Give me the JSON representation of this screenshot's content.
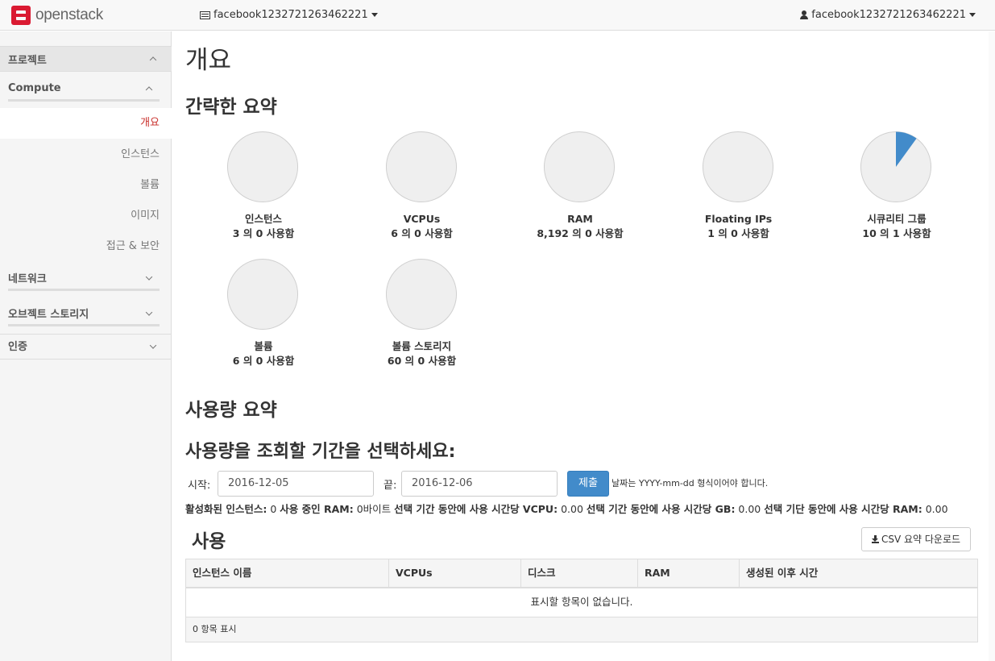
{
  "app": {
    "logo_text": "openstack"
  },
  "topbar": {
    "project": "facebook1232721263462221",
    "user": "facebook1232721263462221"
  },
  "sidebar": {
    "project_label": "프로젝트",
    "compute_label": "Compute",
    "items": [
      {
        "label": "개요",
        "active": true
      },
      {
        "label": "인스턴스"
      },
      {
        "label": "볼륨"
      },
      {
        "label": "이미지"
      },
      {
        "label": "접근 & 보안"
      }
    ],
    "network_label": "네트워크",
    "object_storage_label": "오브젝트 스토리지",
    "identity_label": "인증"
  },
  "main": {
    "title": "개요",
    "summary_heading": "간략한 요약",
    "quotas": [
      {
        "name": "인스턴스",
        "text": "3 의 0 사용함",
        "used": 0,
        "total": 3
      },
      {
        "name": "VCPUs",
        "text": "6 의 0 사용함",
        "used": 0,
        "total": 6
      },
      {
        "name": "RAM",
        "text": "8,192 의 0 사용함",
        "used": 0,
        "total": 8192
      },
      {
        "name": "Floating IPs",
        "text": "1 의 0 사용함",
        "used": 0,
        "total": 1
      },
      {
        "name": "시큐리티 그룹",
        "text": "10 의 1 사용함",
        "used": 1,
        "total": 10
      },
      {
        "name": "볼륨",
        "text": "6 의 0 사용함",
        "used": 0,
        "total": 6
      },
      {
        "name": "볼륨 스토리지",
        "text": "60 의 0 사용함",
        "used": 0,
        "total": 60
      }
    ],
    "usage_heading": "사용량 요약",
    "period_heading": "사용량을 조회할 기간을 선택하세요:",
    "start_label": "시작:",
    "start_value": "2016-12-05",
    "end_label": "끝:",
    "end_value": "2016-12-06",
    "submit_label": "제출",
    "date_hint": "날짜는 YYYY-mm-dd 형식이어야 합니다.",
    "stats": {
      "active_instances_label": "활성화된 인스턴스:",
      "active_instances_value": "0",
      "ram_label": "사용 중인 RAM:",
      "ram_value": "0바이트",
      "vcpu_label": "선택 기간 동안에 사용 시간당 VCPU:",
      "vcpu_value": "0.00",
      "gb_label": "선택 기간 동안에 사용 시간당 GB:",
      "gb_value": "0.00",
      "ram_hours_label": "선택 기단 동안에 사용 시간당 RAM:",
      "ram_hours_value": "0.00"
    },
    "usage_table_heading": "사용",
    "csv_button": "CSV 요약 다운로드",
    "table": {
      "columns": [
        "인스턴스 이름",
        "VCPUs",
        "디스크",
        "RAM",
        "생성된 이후 시간"
      ],
      "empty_text": "표시할 항목이 없습니다.",
      "footer": "0 항목 표시"
    }
  },
  "colors": {
    "accent": "#428bca",
    "pie_fill": "#efefef",
    "pie_used": "#428bca",
    "active_nav": "#c9302c"
  }
}
